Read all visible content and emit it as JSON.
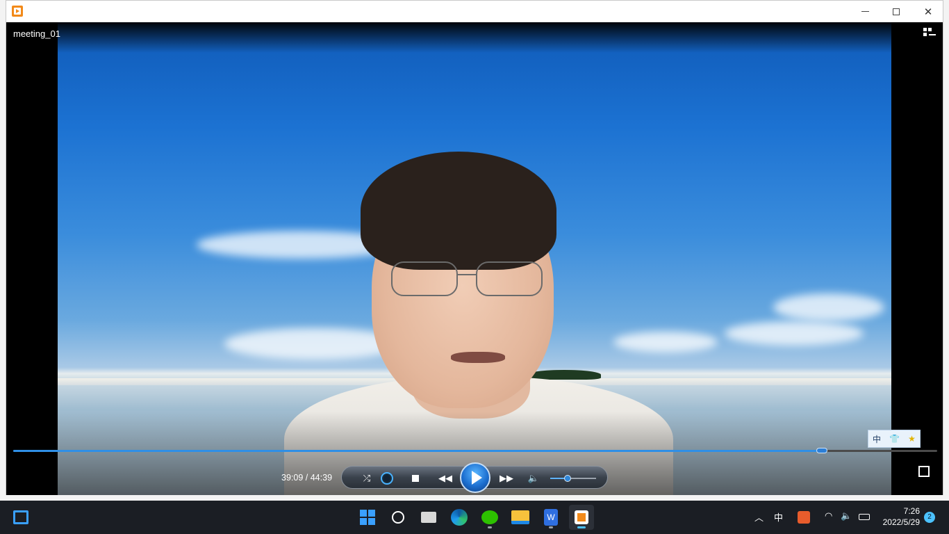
{
  "window": {
    "title": "meeting_01"
  },
  "player": {
    "time_current": "39:09",
    "time_sep": "/",
    "time_total": "44:39",
    "progress_fraction": 0.875,
    "volume_fraction": 0.38
  },
  "ime_toolbar": {
    "lang": "中",
    "skin_icon": "shirt-icon",
    "star_icon": "star-icon"
  },
  "taskbar": {
    "apps": [
      "widgets",
      "start",
      "search",
      "task-view",
      "edge",
      "wechat",
      "file-explorer",
      "wps-writer",
      "media-player"
    ],
    "tray_lang": "中",
    "clock_time": "7:26",
    "clock_date": "2022/5/29",
    "notifications": "2"
  },
  "colors": {
    "accent": "#2f8fe6",
    "taskbar": "#1b1e24",
    "start": "#3aa0ff"
  }
}
